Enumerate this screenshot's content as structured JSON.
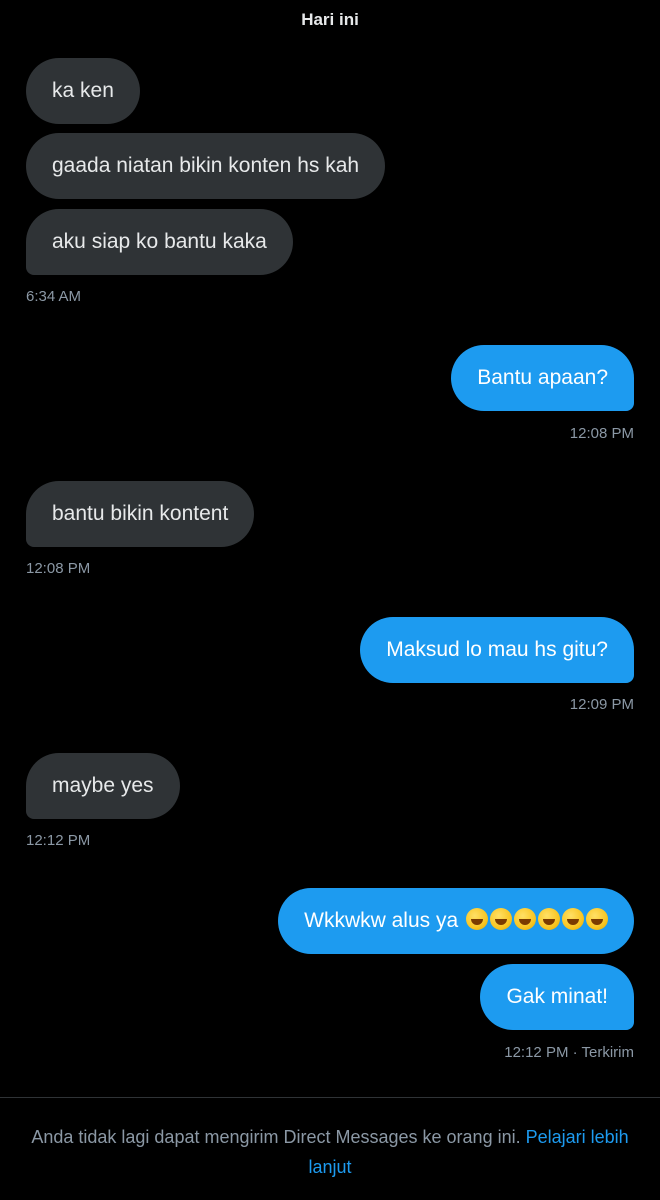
{
  "conversation": {
    "date_label": "Hari ini",
    "messages": [
      {
        "text": "ka ken"
      },
      {
        "text": "gaada niatan bikin konten hs kah"
      },
      {
        "text": "aku siap ko bantu kaka",
        "time": "6:34 AM"
      },
      {
        "text": "Bantu apaan?",
        "time": "12:08 PM"
      },
      {
        "text": "bantu bikin kontent",
        "time": "12:08 PM"
      },
      {
        "text": "Maksud lo mau hs gitu?",
        "time": "12:09 PM"
      },
      {
        "text": "maybe yes",
        "time": "12:12 PM"
      },
      {
        "text": "Wkkwkw alus ya ",
        "emoji_name": "rolling-on-floor-laughing-icon",
        "emoji_count": 6
      },
      {
        "text": "Gak minat!",
        "time": "12:12 PM · Terkirim"
      }
    ]
  },
  "footer": {
    "notice": "Anda tidak lagi dapat mengirim Direct Messages ke orang ini. ",
    "link": "Pelajari lebih lanjut"
  },
  "colors": {
    "background": "#000000",
    "incoming_bubble": "#2f3336",
    "outgoing_bubble": "#1d9bf0",
    "muted_text": "#8b98a5",
    "link": "#1d9bf0"
  }
}
